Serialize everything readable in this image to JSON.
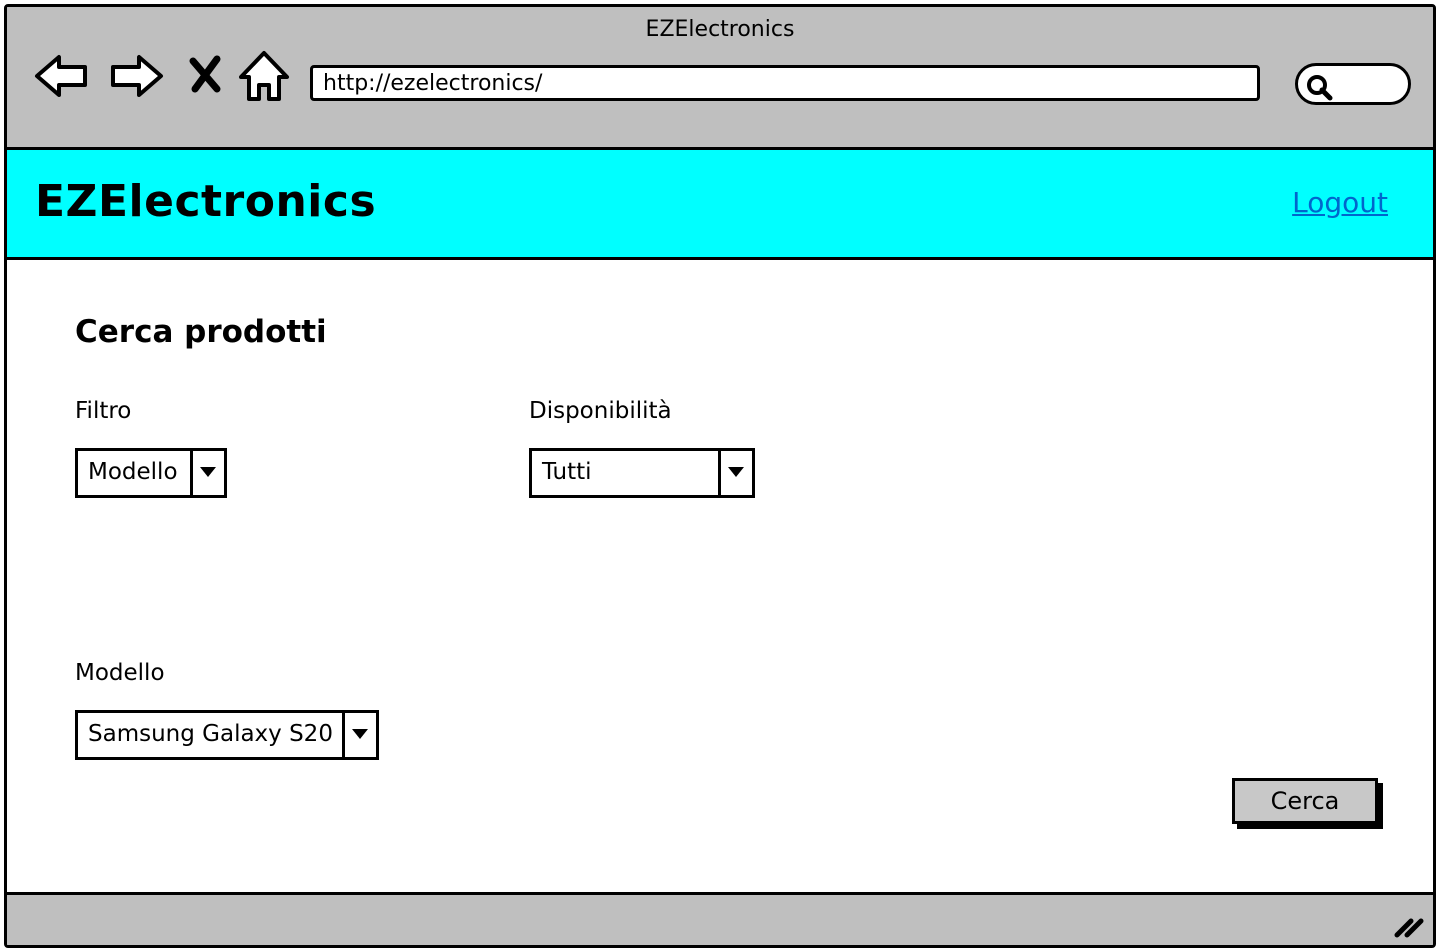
{
  "window": {
    "title": "EZElectronics"
  },
  "browser": {
    "nav_icons": [
      "back-arrow-icon",
      "forward-arrow-icon",
      "stop-icon",
      "home-icon"
    ],
    "url": "http://ezelectronics/",
    "search_icon": "search-icon"
  },
  "header": {
    "brand": "EZElectronics",
    "logout": "Logout",
    "background_color": "#00ffff",
    "link_color": "#0066cc"
  },
  "main": {
    "title": "Cerca prodotti",
    "filter": {
      "label": "Filtro",
      "value": "Modello"
    },
    "availability": {
      "label": "Disponibilità",
      "value": "Tutti"
    },
    "model": {
      "label": "Modello",
      "value": "Samsung Galaxy S20"
    },
    "search_button": "Cerca"
  },
  "statusbar": {
    "grip_icon": "resize-grip-icon"
  }
}
